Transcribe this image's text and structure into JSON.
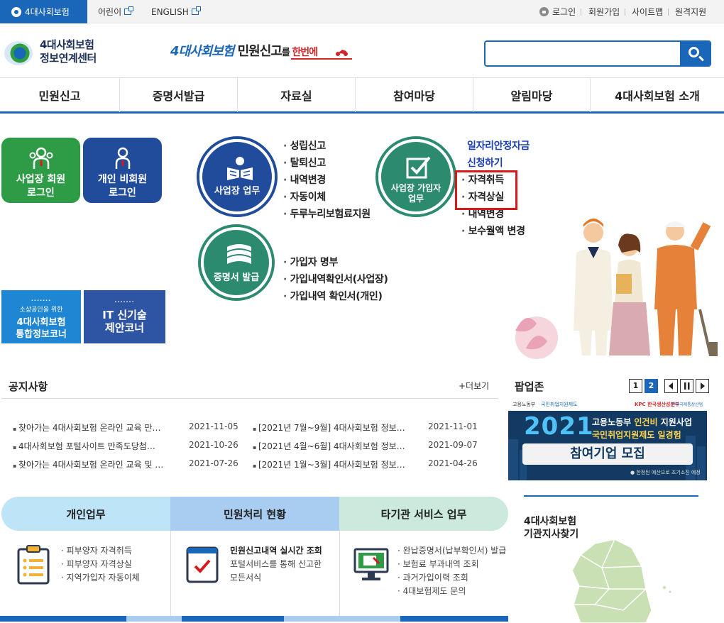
{
  "topbar": {
    "active_tab": "4대사회보험",
    "kids": "어린이",
    "english": "ENGLISH",
    "login": "로그인",
    "join": "회원가입",
    "sitemap": "사이트맵",
    "remote": "원격지원"
  },
  "header": {
    "logo_line1": "4대사회보험",
    "logo_line2": "정보연계센터",
    "slogan_part1": "4대사회보험",
    "slogan_part2": " 민원신고",
    "slogan_part3": "를 ",
    "slogan_part4": "한번에",
    "search_placeholder": ""
  },
  "nav": [
    "민원신고",
    "증명서발급",
    "자료실",
    "참여마당",
    "알림마당",
    "4대사회보험 소개"
  ],
  "login_tiles": {
    "business": "사업장 회원\n로그인",
    "personal": "개인 비회원\n로그인"
  },
  "small_banners": {
    "sme_small": "소상공인을 위한",
    "sme_line1": "4대사회보험",
    "sme_line2": "통합정보코너",
    "it_line1": "IT 신기술",
    "it_line2": "제안코너"
  },
  "services": {
    "biz_work": {
      "label": "사업장 업무",
      "items": [
        "성립신고",
        "탈퇴신고",
        "내역변경",
        "자동이체",
        "두루누리보험료지원"
      ]
    },
    "member_work": {
      "label_line1": "사업장 가입자",
      "label_line2": "업무",
      "highlight_line1": "일자리안정자금",
      "highlight_line2": "신청하기",
      "items": [
        "자격취득",
        "자격상실",
        "내역변경",
        "보수월액 변경"
      ]
    },
    "cert": {
      "label": "증명서 발급",
      "items": [
        "가입자 명부",
        "가입내역확인서(사업장)",
        "가입내역 확인서(개인)"
      ]
    }
  },
  "notice": {
    "title": "공지사항",
    "more": "+더보기",
    "left": [
      {
        "title": "찾아가는 4대사회보험 온라인 교육 만…",
        "date": "2021-11-05"
      },
      {
        "title": "4대사회보험 포털사이트 만족도당첨…",
        "date": "2021-10-26"
      },
      {
        "title": "찾아가는 4대사회보험 온라인 교육 및 …",
        "date": "2021-07-26"
      }
    ],
    "right": [
      {
        "title": "[2021년 7월~9월] 4대사회보험 정보…",
        "date": "2021-11-01"
      },
      {
        "title": "[2021년 4월~6월] 4대사회보험 정보…",
        "date": "2021-09-07"
      },
      {
        "title": "[2021년 1월~3월] 4대사회보험 정보…",
        "date": "2021-04-26"
      }
    ]
  },
  "popup": {
    "title": "팝업존",
    "page1": "1",
    "page2": "2",
    "banner_org1": "고용노동부",
    "banner_org2": "국민취업지원제도",
    "banner_org3": "KPC 한국생산성본부",
    "banner_org4": "한국국제통상산업",
    "banner_year": "2021",
    "banner_line1a": "고용노동부 ",
    "banner_line1b": "인건비",
    "banner_line1c": " 지원사업",
    "banner_line2": "국민취업지원제도 일경험",
    "banner_cta": "참여기업 모집",
    "banner_note": "● 한정된 예산으로 조기소진 예정"
  },
  "bottom_tabs": [
    "개인업무",
    "민원처리 현황",
    "타기관 서비스 업무"
  ],
  "personal_list": [
    "피부양자 자격취득",
    "피부양자 자격상실",
    "지역가입자 자동이체"
  ],
  "realtime": {
    "title": "민원신고내역 실시간 조회",
    "desc_line1": "포털서비스를 통해 신고한",
    "desc_line2": "모든서식"
  },
  "other_list": [
    "완납증명서(납부확인서) 발급",
    "보험료 부과내역 조회",
    "과거가입이력 조회",
    "4대보험제도 문의"
  ],
  "branch": {
    "line1": "4대사회보험",
    "line2": "기관지사찾기"
  },
  "colors": {
    "brand_blue": "#1a66b8",
    "green": "#2e9b46",
    "navy": "#214c9c",
    "teal": "#2c8a6e",
    "highlight_red": "#d8191c"
  }
}
